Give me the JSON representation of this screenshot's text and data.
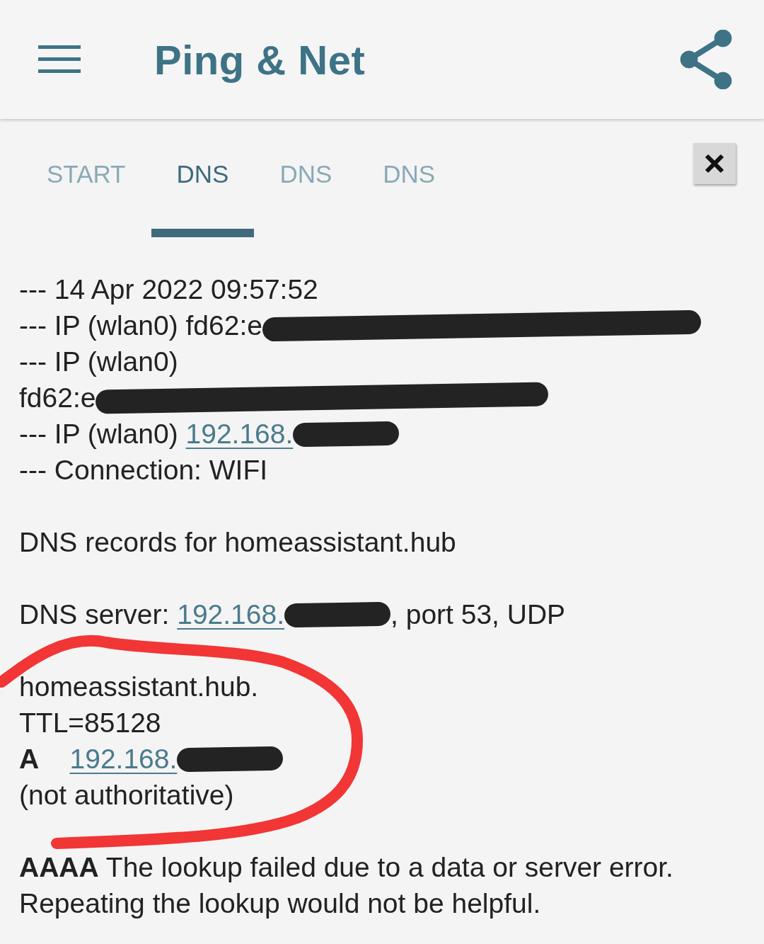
{
  "app_bar": {
    "title": "Ping & Net"
  },
  "tabs": [
    {
      "label": "START",
      "selected": false
    },
    {
      "label": "DNS",
      "selected": true
    },
    {
      "label": "DNS",
      "selected": false
    },
    {
      "label": "DNS",
      "selected": false
    }
  ],
  "log_blocks": [
    [
      {
        "text": "--- 14 Apr 2022 09:57:52",
        "redacted": false
      },
      {
        "text": "--- IP (wlan0) fd62:e",
        "redacted": true
      },
      {
        "text": "--- IP (wlan0)",
        "redacted": false
      },
      {
        "text": "fd62:e",
        "redacted": true
      },
      {
        "text": "--- IP (wlan0) ",
        "link": "192.168.",
        "redacted": true
      },
      {
        "text": "--- Connection: WIFI",
        "redacted": false
      }
    ],
    [
      {
        "text": "DNS records for homeassistant.hub",
        "redacted": false
      }
    ],
    [
      {
        "text": "DNS server: ",
        "link": "192.168.",
        "redacted": true,
        "suffix": ", port 53, UDP"
      }
    ],
    [
      {
        "text": "homeassistant.hub.",
        "redacted": false
      },
      {
        "text": "TTL=85128",
        "redacted": false
      },
      {
        "text": "**A**    ",
        "link": "192.168.",
        "redacted": true
      },
      {
        "text": "(not authoritative)",
        "redacted": false
      }
    ],
    [
      {
        "text": "**AAAA**   The lookup failed due to a data or server error. Repeating the lookup would not be helpful.",
        "redacted": false
      }
    ]
  ]
}
